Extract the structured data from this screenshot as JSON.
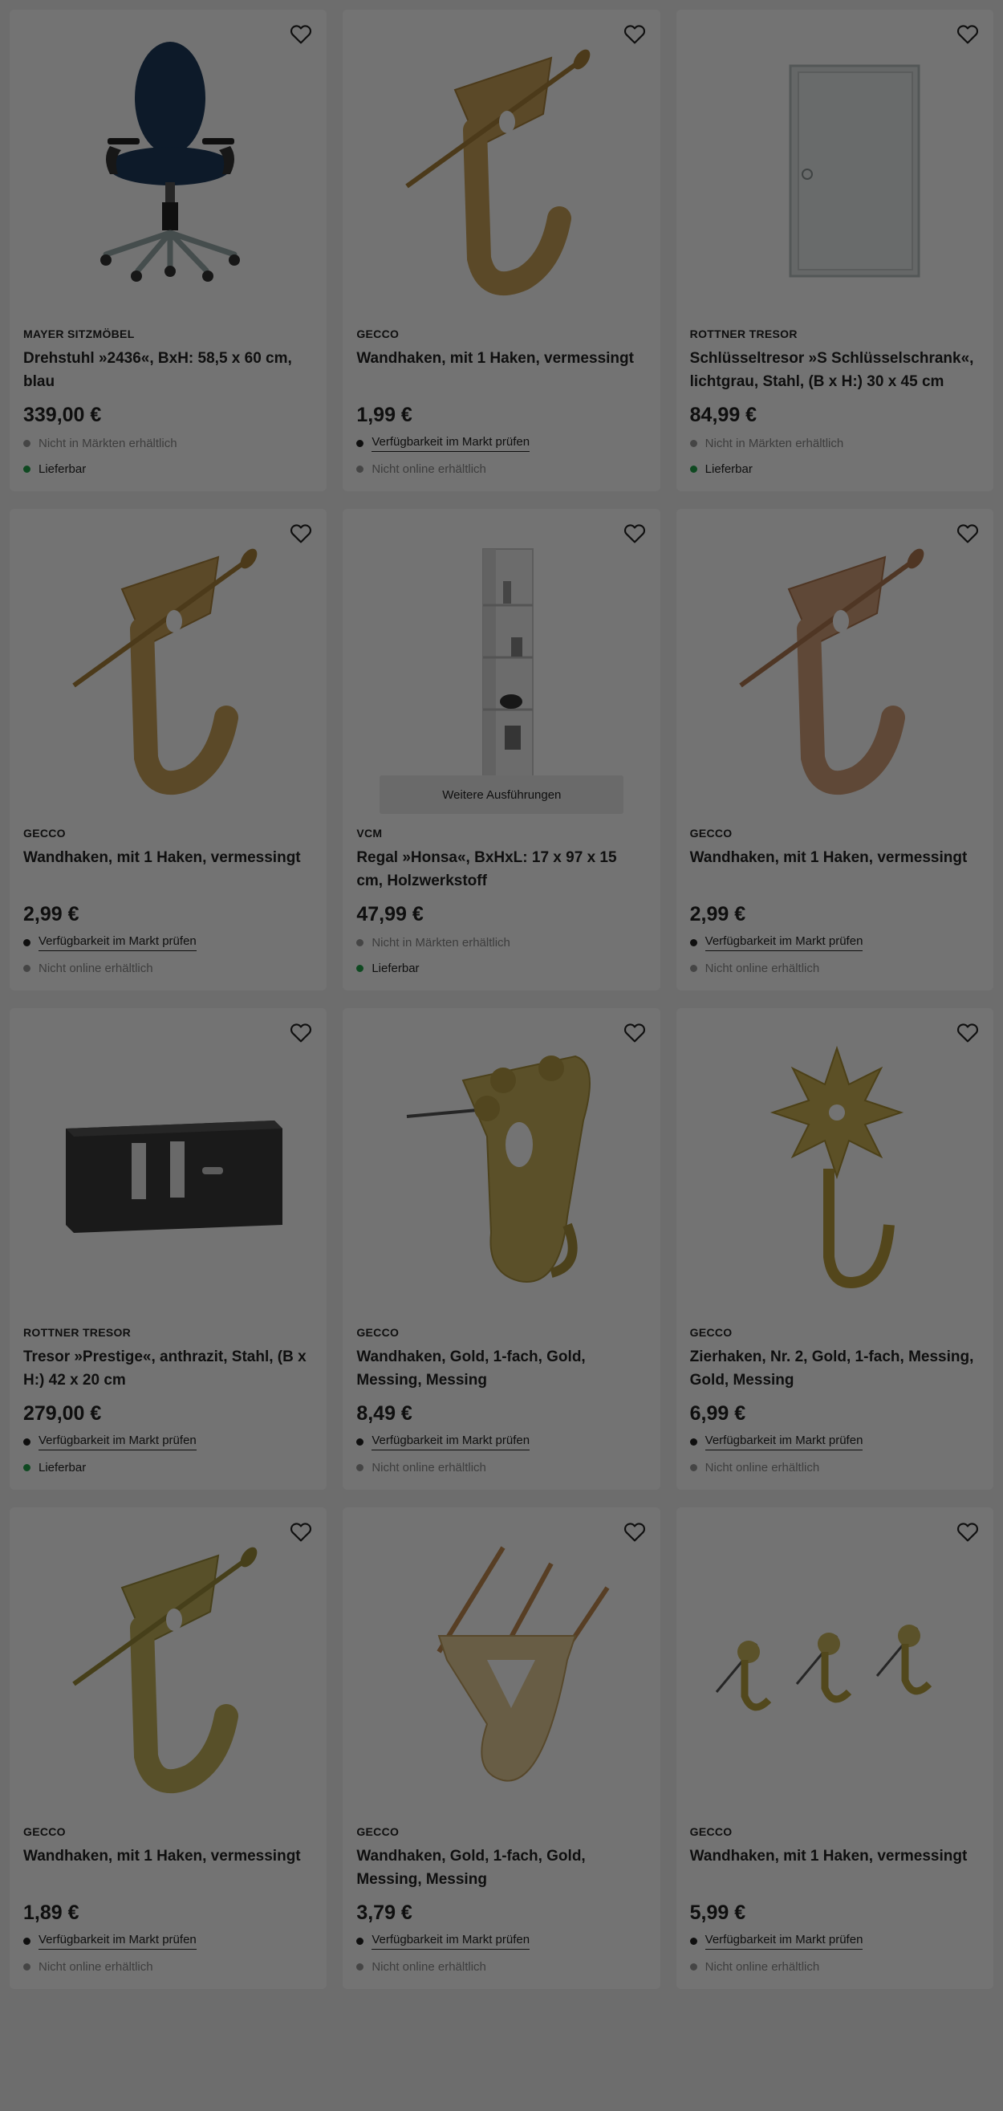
{
  "colors": {
    "available": "#22a34a",
    "unavailable": "#999999",
    "overlay": "rgba(0,0,0,0.55)"
  },
  "common": {
    "variant_button_label": "Weitere Ausführungen",
    "heart_icon": "heart-outline-icon"
  },
  "products": [
    {
      "brand": "MAYER SITZMÖBEL",
      "title": "Drehstuhl »2436«, BxH: 58,5 x 60 cm, blau",
      "price": "339,00 €",
      "image": "office-chair",
      "status1": {
        "text": "Nicht in Märkten erhältlich",
        "kind": "muted"
      },
      "status2": {
        "text": "Lieferbar",
        "kind": "available"
      }
    },
    {
      "brand": "GECCO",
      "title": "Wandhaken, mit 1 Haken, vermessingt",
      "price": "1,99 €",
      "image": "hook-nail",
      "status1": {
        "text": "Verfügbarkeit im Markt prüfen",
        "kind": "link"
      },
      "status2": {
        "text": "Nicht online erhältlich",
        "kind": "muted"
      }
    },
    {
      "brand": "ROTTNER TRESOR",
      "title": "Schlüsseltresor »S Schlüsselschrank«, lichtgrau, Stahl, (B x H:) 30 x 45 cm",
      "price": "84,99 €",
      "image": "key-cabinet",
      "status1": {
        "text": "Nicht in Märkten erhältlich",
        "kind": "muted"
      },
      "status2": {
        "text": "Lieferbar",
        "kind": "available"
      }
    },
    {
      "brand": "GECCO",
      "title": "Wandhaken, mit 1 Haken, vermessingt",
      "price": "2,99 €",
      "image": "hook-nail",
      "status1": {
        "text": "Verfügbarkeit im Markt prüfen",
        "kind": "link"
      },
      "status2": {
        "text": "Nicht online erhältlich",
        "kind": "muted"
      }
    },
    {
      "brand": "VCM",
      "title": "Regal »Honsa«, BxHxL: 17 x 97 x 15 cm, Holzwerkstoff",
      "price": "47,99 €",
      "image": "shelf",
      "has_variants": true,
      "status1": {
        "text": "Nicht in Märkten erhältlich",
        "kind": "muted"
      },
      "status2": {
        "text": "Lieferbar",
        "kind": "available"
      }
    },
    {
      "brand": "GECCO",
      "title": "Wandhaken, mit 1 Haken, vermessingt",
      "price": "2,99 €",
      "image": "hook-nail-copper",
      "status1": {
        "text": "Verfügbarkeit im Markt prüfen",
        "kind": "link"
      },
      "status2": {
        "text": "Nicht online erhältlich",
        "kind": "muted"
      }
    },
    {
      "brand": "ROTTNER TRESOR",
      "title": "Tresor »Prestige«, anthrazit, Stahl, (B x H:) 42 x 20 cm",
      "price": "279,00 €",
      "image": "safe",
      "status1": {
        "text": "Verfügbarkeit im Markt prüfen",
        "kind": "link"
      },
      "status2": {
        "text": "Lieferbar",
        "kind": "available"
      }
    },
    {
      "brand": "GECCO",
      "title": "Wandhaken, Gold, 1-fach, Gold, Messing, Messing",
      "price": "8,49 €",
      "image": "hook-plate",
      "status1": {
        "text": "Verfügbarkeit im Markt prüfen",
        "kind": "link"
      },
      "status2": {
        "text": "Nicht online erhältlich",
        "kind": "muted"
      }
    },
    {
      "brand": "GECCO",
      "title": "Zierhaken, Nr. 2, Gold, 1-fach, Messing, Gold, Messing",
      "price": "6,99 €",
      "image": "hook-flower",
      "status1": {
        "text": "Verfügbarkeit im Markt prüfen",
        "kind": "link"
      },
      "status2": {
        "text": "Nicht online erhältlich",
        "kind": "muted"
      }
    },
    {
      "brand": "GECCO",
      "title": "Wandhaken, mit 1 Haken, vermessingt",
      "price": "1,89 €",
      "image": "hook-nail-olive",
      "status1": {
        "text": "Verfügbarkeit im Markt prüfen",
        "kind": "link"
      },
      "status2": {
        "text": "Nicht online erhältlich",
        "kind": "muted"
      }
    },
    {
      "brand": "GECCO",
      "title": "Wandhaken, Gold, 1-fach, Gold, Messing, Messing",
      "price": "3,79 €",
      "image": "hook-triple-nail",
      "status1": {
        "text": "Verfügbarkeit im Markt prüfen",
        "kind": "link"
      },
      "status2": {
        "text": "Nicht online erhältlich",
        "kind": "muted"
      }
    },
    {
      "brand": "GECCO",
      "title": "Wandhaken, mit 1 Haken, vermessingt",
      "price": "5,99 €",
      "image": "hook-set-three",
      "status1": {
        "text": "Verfügbarkeit im Markt prüfen",
        "kind": "link"
      },
      "status2": {
        "text": "Nicht online erhältlich",
        "kind": "muted"
      }
    }
  ]
}
